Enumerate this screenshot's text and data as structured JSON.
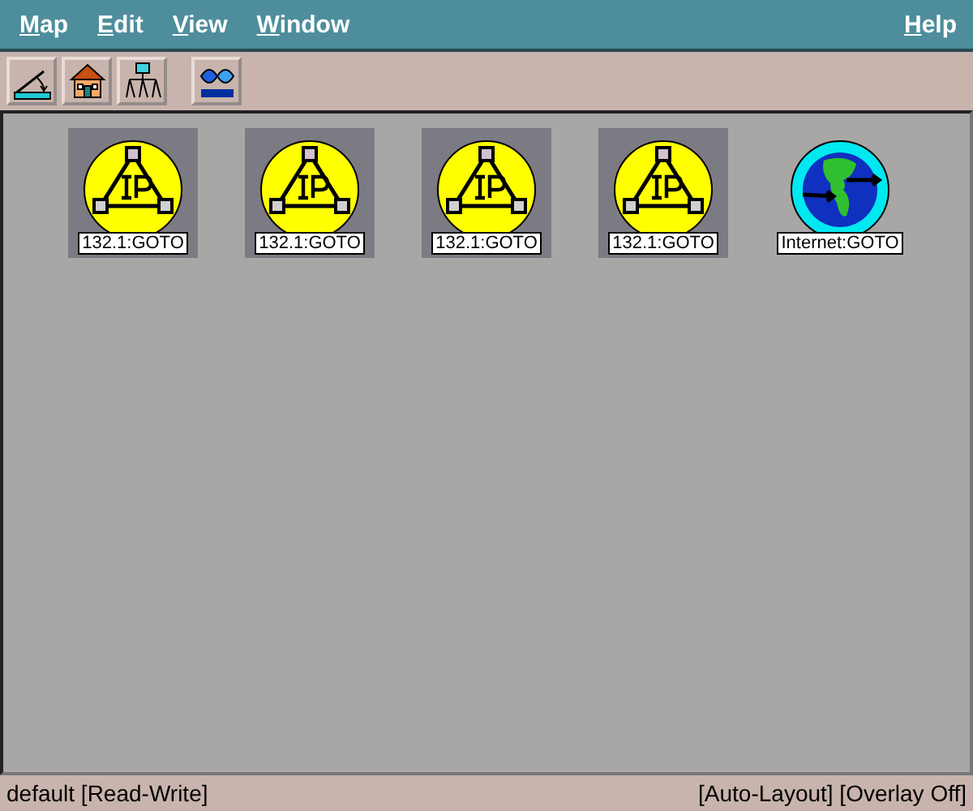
{
  "menu": [
    {
      "label": "Map"
    },
    {
      "label": "Edit"
    },
    {
      "label": "View"
    },
    {
      "label": "Window"
    }
  ],
  "help_menu": {
    "label": "Help"
  },
  "toolbar": [
    {
      "kind": "ruler"
    },
    {
      "kind": "home"
    },
    {
      "kind": "tree"
    },
    {
      "kind": "logo"
    }
  ],
  "map_symbols": [
    {
      "kind": "ip",
      "label": "132.1:GOTO",
      "selected": true
    },
    {
      "kind": "ip",
      "label": "132.1:GOTO",
      "selected": true
    },
    {
      "kind": "ip",
      "label": "132.1:GOTO",
      "selected": true
    },
    {
      "kind": "ip",
      "label": "132.1:GOTO",
      "selected": true
    },
    {
      "kind": "internet",
      "label": "Internet:GOTO",
      "selected": false
    }
  ],
  "status_bar": {
    "left": "default [Read-Write]",
    "right": "[Auto-Layout] [Overlay Off]"
  }
}
